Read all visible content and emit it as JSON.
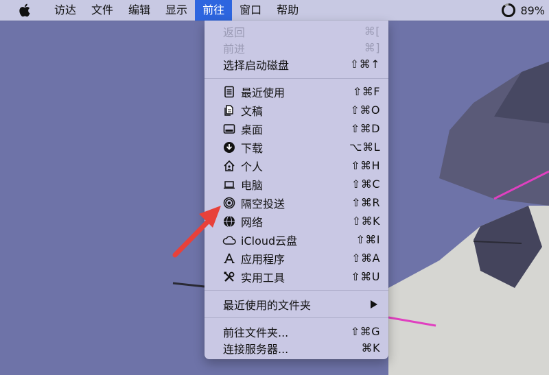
{
  "menubar": {
    "items": [
      "访达",
      "文件",
      "编辑",
      "显示",
      "前往",
      "窗口",
      "帮助"
    ],
    "active": "前往",
    "battery_percent": "89%",
    "battery_level": 0.89
  },
  "go_menu": {
    "top": [
      {
        "label": "返回",
        "shortcut": "⌘[",
        "disabled": true
      },
      {
        "label": "前进",
        "shortcut": "⌘]",
        "disabled": true
      },
      {
        "label": "选择启动磁盘",
        "shortcut": "⇧⌘↑"
      }
    ],
    "places": [
      {
        "label": "最近使用",
        "shortcut": "⇧⌘F",
        "icon": "recents-icon"
      },
      {
        "label": "文稿",
        "shortcut": "⇧⌘O",
        "icon": "documents-icon"
      },
      {
        "label": "桌面",
        "shortcut": "⇧⌘D",
        "icon": "desktop-icon"
      },
      {
        "label": "下载",
        "shortcut": "⌥⌘L",
        "icon": "downloads-icon"
      },
      {
        "label": "个人",
        "shortcut": "⇧⌘H",
        "icon": "home-icon"
      },
      {
        "label": "电脑",
        "shortcut": "⇧⌘C",
        "icon": "computer-icon"
      },
      {
        "label": "隔空投送",
        "shortcut": "⇧⌘R",
        "icon": "airdrop-icon"
      },
      {
        "label": "网络",
        "shortcut": "⇧⌘K",
        "icon": "network-icon"
      },
      {
        "label": "iCloud云盘",
        "shortcut": "⇧⌘I",
        "icon": "icloud-icon"
      },
      {
        "label": "应用程序",
        "shortcut": "⇧⌘A",
        "icon": "applications-icon"
      },
      {
        "label": "实用工具",
        "shortcut": "⇧⌘U",
        "icon": "utilities-icon"
      }
    ],
    "recent_folders": {
      "label": "最近使用的文件夹"
    },
    "bottom": [
      {
        "label": "前往文件夹...",
        "shortcut": "⇧⌘G"
      },
      {
        "label": "连接服务器...",
        "shortcut": "⌘K"
      }
    ]
  },
  "colors": {
    "menubar_bg": "#c8c9e3",
    "active_blue": "#2d65df",
    "menu_bg": "#c9c8e4",
    "desktop_bg": "#6e73a8",
    "annotation_arrow": "#e8413a"
  }
}
